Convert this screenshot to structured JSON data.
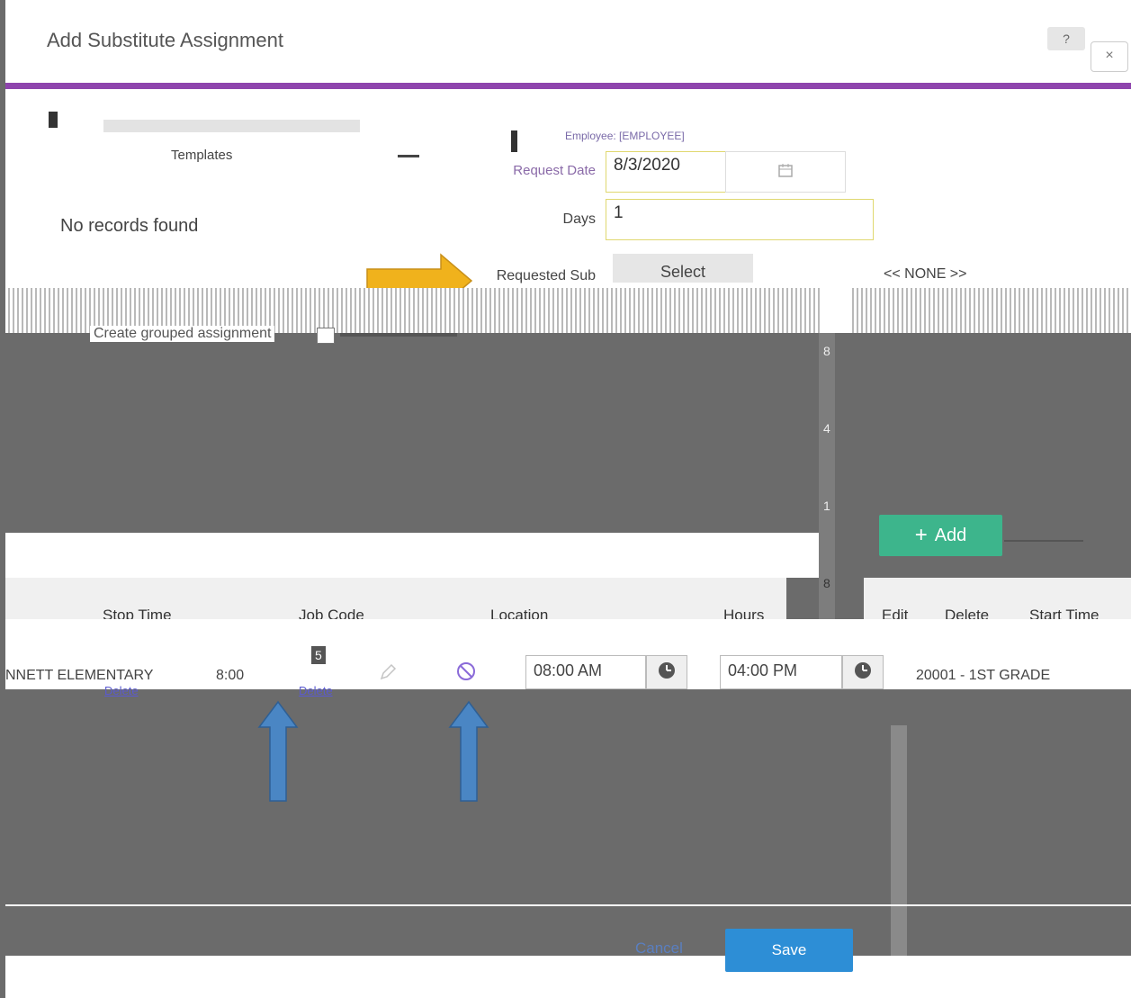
{
  "dialog": {
    "title": "Add Substitute Assignment",
    "help_label": "?",
    "close_label": "×"
  },
  "left_panel": {
    "templates_label": "Templates",
    "no_records": "No records found"
  },
  "form": {
    "employee_info": "Employee: [EMPLOYEE]",
    "request_date_label": "Request Date",
    "request_date_value": "8/3/2020",
    "days_label": "Days",
    "days_value": "1",
    "requested_sub_label": "Requested Sub",
    "select_label": "Select",
    "requested_sub_value": "<< NONE >>",
    "grouped_label": "Create grouped assignment"
  },
  "side_numbers": [
    "8",
    "4",
    "1",
    "8"
  ],
  "add_button_label": "Add",
  "table": {
    "headers": {
      "stop_time": "Stop Time",
      "job_code": "Job Code",
      "location": "Location",
      "hours": "Hours",
      "edit": "Edit",
      "delete": "Delete",
      "start_time": "Start Time"
    },
    "row": {
      "location": "NNETT ELEMENTARY",
      "stop_time": "8:00",
      "number": "5",
      "start_time": "08:00 AM",
      "end_time": "04:00 PM",
      "job_code": "20001 - 1ST GRADE",
      "link_label": "Delete"
    }
  },
  "footer": {
    "cancel_label": "Cancel",
    "save_label": "Save"
  },
  "colors": {
    "accent_purple": "#8e44ad",
    "add_green": "#3db58c",
    "save_blue": "#2d8ed6",
    "arrow_orange": "#f0b21c",
    "arrow_blue": "#4a86c4",
    "overlay": "#6b6b6b"
  },
  "icons": [
    "calendar-icon",
    "clock-icon",
    "pencil-icon",
    "ban-icon",
    "plus-icon"
  ]
}
